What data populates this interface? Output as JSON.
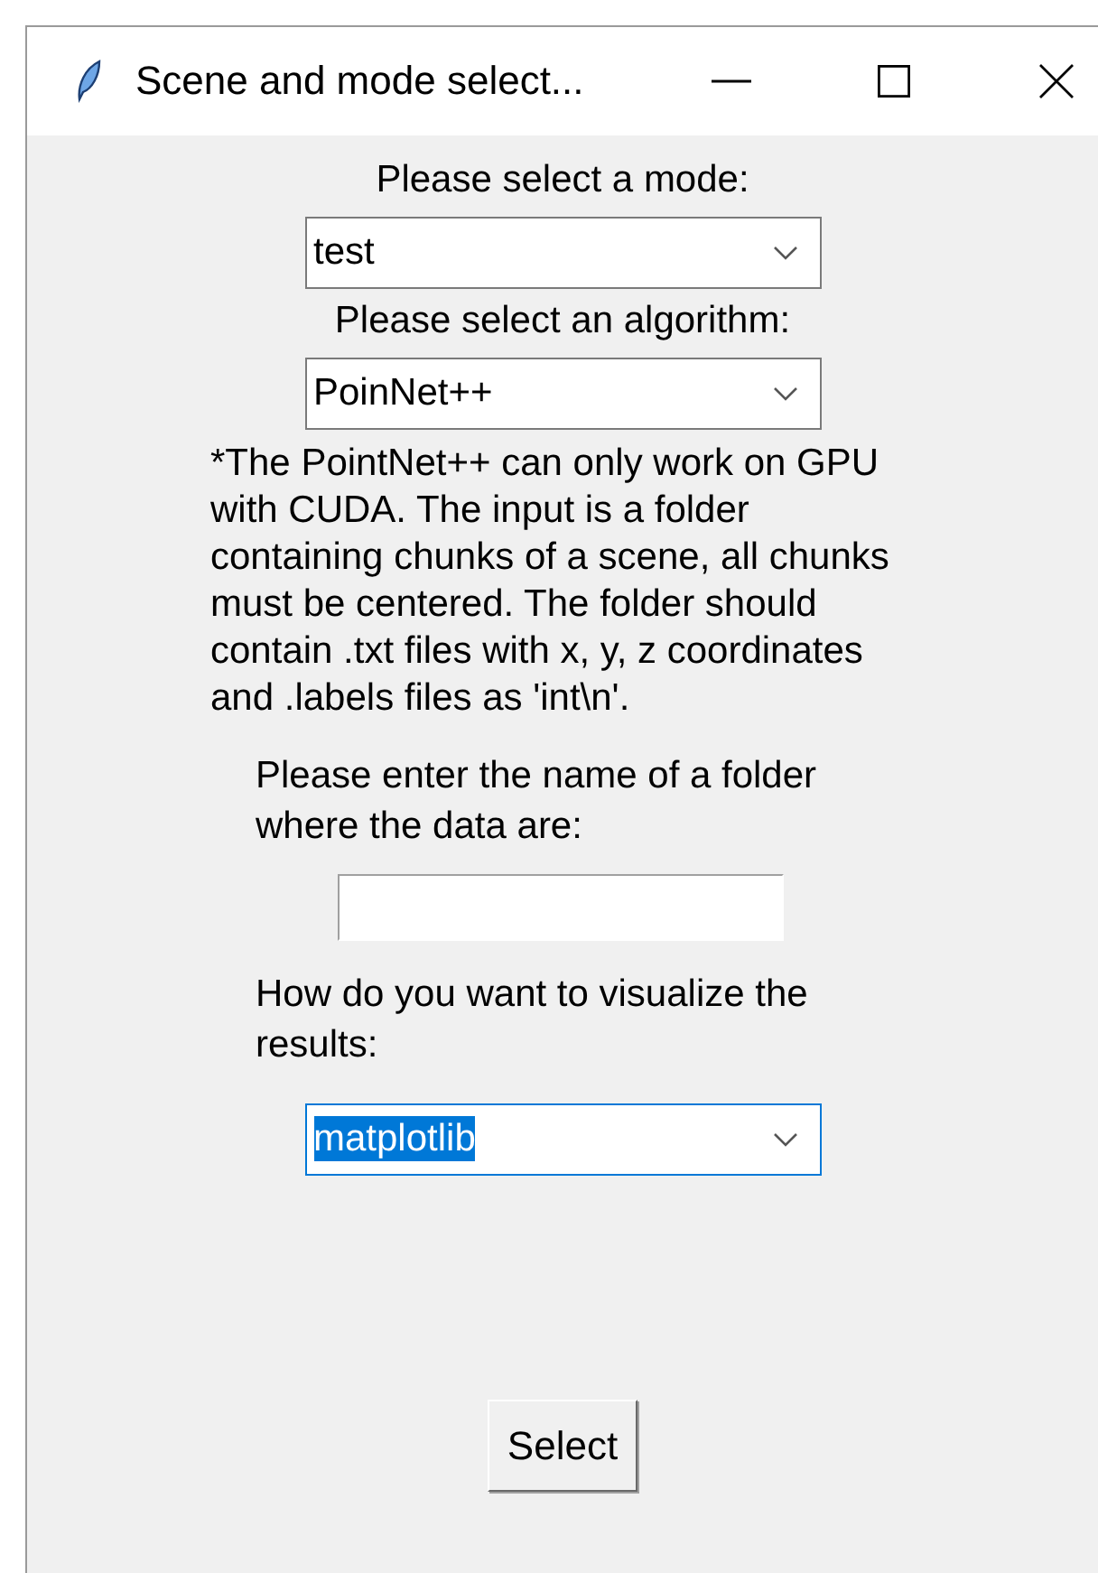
{
  "window": {
    "title": "Scene and mode select..."
  },
  "form": [
    {
      "kind": "label",
      "text": "Please select a mode:"
    },
    {
      "kind": "combobox",
      "value": "test",
      "text_selected": false
    },
    {
      "kind": "label",
      "text": "Please select an algorithm:"
    },
    {
      "kind": "combobox",
      "value": "PoinNet++",
      "text_selected": false
    },
    {
      "kind": "note",
      "text": "*The PointNet++ can only work on GPU with CUDA. The input is a folder containing chunks of a scene, all chunks must be centered. The folder should contain .txt files with x, y, z coordinates and .labels files as 'int\\n'."
    },
    {
      "kind": "label",
      "text": "Please enter the name of a folder where the data are:"
    },
    {
      "kind": "entry"
    },
    {
      "kind": "label",
      "text": "How do you want to visualize the results:"
    },
    {
      "kind": "combobox",
      "value": "matplotlib",
      "text_selected": true
    }
  ],
  "buttons": [
    "Select"
  ]
}
